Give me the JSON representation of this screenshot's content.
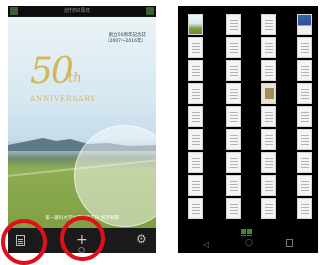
{
  "left_phone": {
    "statusbar": {
      "title": "创刊50周年"
    },
    "cover": {
      "title_lines": [
        "創立50周年記念誌",
        "（2007～2016年）"
      ],
      "logo_number": "50",
      "logo_suffix": "th",
      "logo_word": "ANNIVERSARY",
      "footer": "第一薬科大学付属高等学校 男子新聞"
    },
    "bottom_bar": {
      "doc_icon": "document-icon",
      "add_icon": "plus-icon",
      "settings_icon": "gear-icon"
    },
    "highlight_color": "#e0101a"
  },
  "right_phone": {
    "columns": [
      [
        "cover",
        "blank",
        "blank",
        "blank",
        "blank",
        "blank",
        "blank",
        "blank",
        "blank",
        "blank"
      ],
      [
        "blank",
        "blank",
        "blank",
        "blank",
        "blank",
        "blank",
        "blank",
        "blank",
        "blank",
        "blank"
      ],
      [
        "blank",
        "blank",
        "blank",
        "photo",
        "blank",
        "blank",
        "blank",
        "blank",
        "blank",
        "blank"
      ],
      [
        "blue",
        "blank",
        "blank",
        "blank",
        "blank",
        "blank",
        "blank",
        "blank",
        "blank",
        "blank"
      ]
    ],
    "nav": {
      "back": "◁",
      "home": "○",
      "recent": "recent-apps-icon"
    },
    "grid_button_color": "#3f8a2e"
  }
}
